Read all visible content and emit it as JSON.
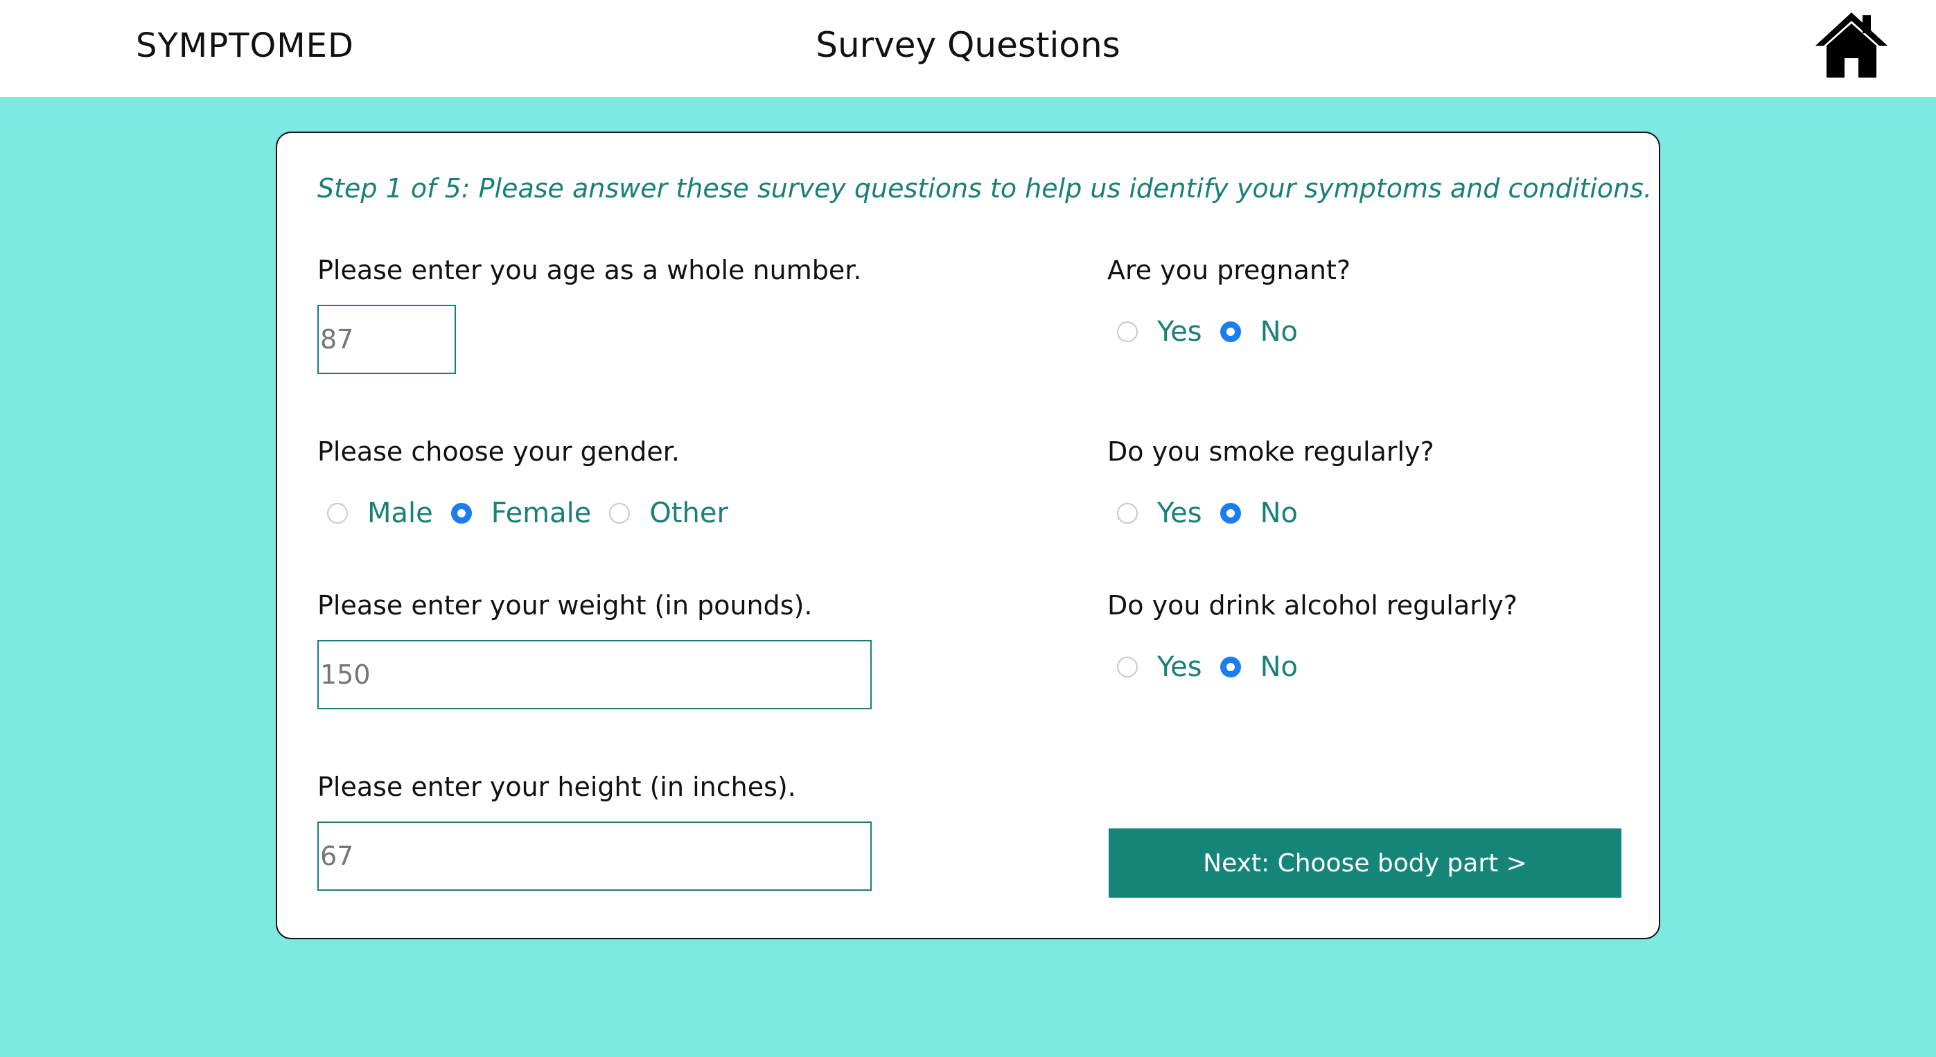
{
  "header": {
    "brand": "SYMPTOMED",
    "title": "Survey Questions",
    "home_icon": "home-icon"
  },
  "survey": {
    "step_text": "Step 1 of 5: Please answer these survey questions to help us identify your symptoms and conditions.",
    "age": {
      "question": "Please enter you age as a whole number.",
      "placeholder": "87"
    },
    "gender": {
      "question": "Please choose your gender.",
      "options": [
        "Male",
        "Female",
        "Other"
      ],
      "selected": "Female"
    },
    "weight": {
      "question": "Please enter your weight (in pounds).",
      "placeholder": "150"
    },
    "height": {
      "question": "Please enter your height (in inches).",
      "placeholder": "67"
    },
    "pregnant": {
      "question": "Are you pregnant?",
      "options": [
        "Yes",
        "No"
      ],
      "selected": "No"
    },
    "smoke": {
      "question": "Do you smoke regularly?",
      "options": [
        "Yes",
        "No"
      ],
      "selected": "No"
    },
    "alcohol": {
      "question": "Do you drink alcohol regularly?",
      "options": [
        "Yes",
        "No"
      ],
      "selected": "No"
    },
    "next_label": "Next: Choose body part >"
  },
  "colors": {
    "background": "#7de9e0",
    "accent": "#15857a",
    "radio_selected": "#1a7ef2"
  }
}
